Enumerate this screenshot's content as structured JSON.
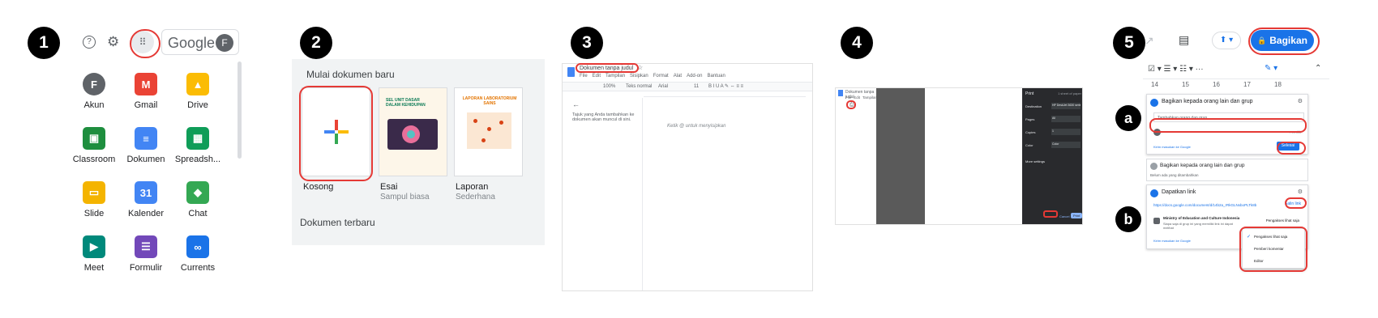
{
  "steps": {
    "s1": "1",
    "s2": "2",
    "s3": "3",
    "s4": "4",
    "s5": "5",
    "sa": "a",
    "sb": "b"
  },
  "panel1": {
    "google_logo": "Google",
    "avatar_letter": "F",
    "apps": [
      {
        "label": "Akun",
        "icon": "account-icon",
        "color": "#5f6368",
        "glyph": "F"
      },
      {
        "label": "Gmail",
        "icon": "gmail-icon",
        "color": "#ea4335",
        "glyph": "M"
      },
      {
        "label": "Drive",
        "icon": "drive-icon",
        "color": "#fbbc04",
        "glyph": "▲"
      },
      {
        "label": "Classroom",
        "icon": "classroom-icon",
        "color": "#1e8e3e",
        "glyph": "▣"
      },
      {
        "label": "Dokumen",
        "icon": "docs-icon",
        "color": "#4285f4",
        "glyph": "≡"
      },
      {
        "label": "Spreadsh...",
        "icon": "sheets-icon",
        "color": "#0f9d58",
        "glyph": "▦"
      },
      {
        "label": "Slide",
        "icon": "slides-icon",
        "color": "#f4b400",
        "glyph": "▭"
      },
      {
        "label": "Kalender",
        "icon": "calendar-icon",
        "color": "#4285f4",
        "glyph": "31"
      },
      {
        "label": "Chat",
        "icon": "chat-icon",
        "color": "#34a853",
        "glyph": "◆"
      },
      {
        "label": "Meet",
        "icon": "meet-icon",
        "color": "#00897b",
        "glyph": "▶"
      },
      {
        "label": "Formulir",
        "icon": "forms-icon",
        "color": "#7248b9",
        "glyph": "☰"
      },
      {
        "label": "Currents",
        "icon": "currents-icon",
        "color": "#1a73e8",
        "glyph": "∞"
      }
    ]
  },
  "panel2": {
    "heading": "Mulai dokumen baru",
    "templates": [
      {
        "label": "Kosong",
        "sub": ""
      },
      {
        "label": "Esai",
        "sub": "Sampul biasa"
      },
      {
        "label": "Laporan",
        "sub": "Sederhana"
      }
    ],
    "esai_title": "SEL UNIT DASAR DALAM KEHIDUPAN",
    "laporan_title": "LAPORAN LABORATORIUM SAINS",
    "recent": "Dokumen terbaru"
  },
  "panel3": {
    "doc_title": "Dokumen tanpa judul",
    "menu": [
      "File",
      "Edit",
      "Tampilan",
      "Sisipkan",
      "Format",
      "Alat",
      "Add-on",
      "Bantuan"
    ],
    "zoom": "100%",
    "style": "Teks normal",
    "font": "Arial",
    "size": "11",
    "outline_hint": "Tajuk yang Anda tambahkan ke dokumen akan muncul di sini.",
    "body_hint": "Ketik @ untuk menyisipkan"
  },
  "panel4": {
    "doc_title": "Dokumen tanpa judul",
    "menu": [
      "File",
      "Edit",
      "Tampilan"
    ],
    "print_title": "Print",
    "sheets": "1 sheet of paper",
    "rows": [
      {
        "label": "Destination",
        "value": "HP DeskJet 3630 series"
      },
      {
        "label": "Pages",
        "value": "All"
      },
      {
        "label": "Copies",
        "value": "1"
      },
      {
        "label": "Color",
        "value": "Color"
      }
    ],
    "more": "More settings",
    "cancel": "Cancel",
    "print": "Print"
  },
  "panel5": {
    "share_button": "Bagikan",
    "ruler": [
      "14",
      "15",
      "16",
      "17",
      "18"
    ],
    "share_dialog_title": "Bagikan kepada orang lain dan grup",
    "add_people_placeholder": "Tambahkan orang dan grup",
    "owner_role": "Pemilik",
    "done": "Selesai",
    "feedback": "Kirim masukan ke Google",
    "share_dialog_title2": "Bagikan kepada orang lain dan grup",
    "not_shared": "Belum ada yang ditambahkan",
    "get_link_title": "Dapatkan link",
    "link_url": "https://docs.google.com/document/d/14b2a_rRkGLNxboPLTk8b",
    "copy_link": "Salin link",
    "org": "Ministry of Education and Culture Indonesia",
    "org_desc": "Siapa saja di grup ini yang memiliki link ini dapat melihat",
    "access_role": "Pengakses lihat saja",
    "feedback2": "Kirim masukan ke Google",
    "role_options": [
      "Pengakses lihat saja",
      "Pemberi komentar",
      "Editor"
    ]
  }
}
